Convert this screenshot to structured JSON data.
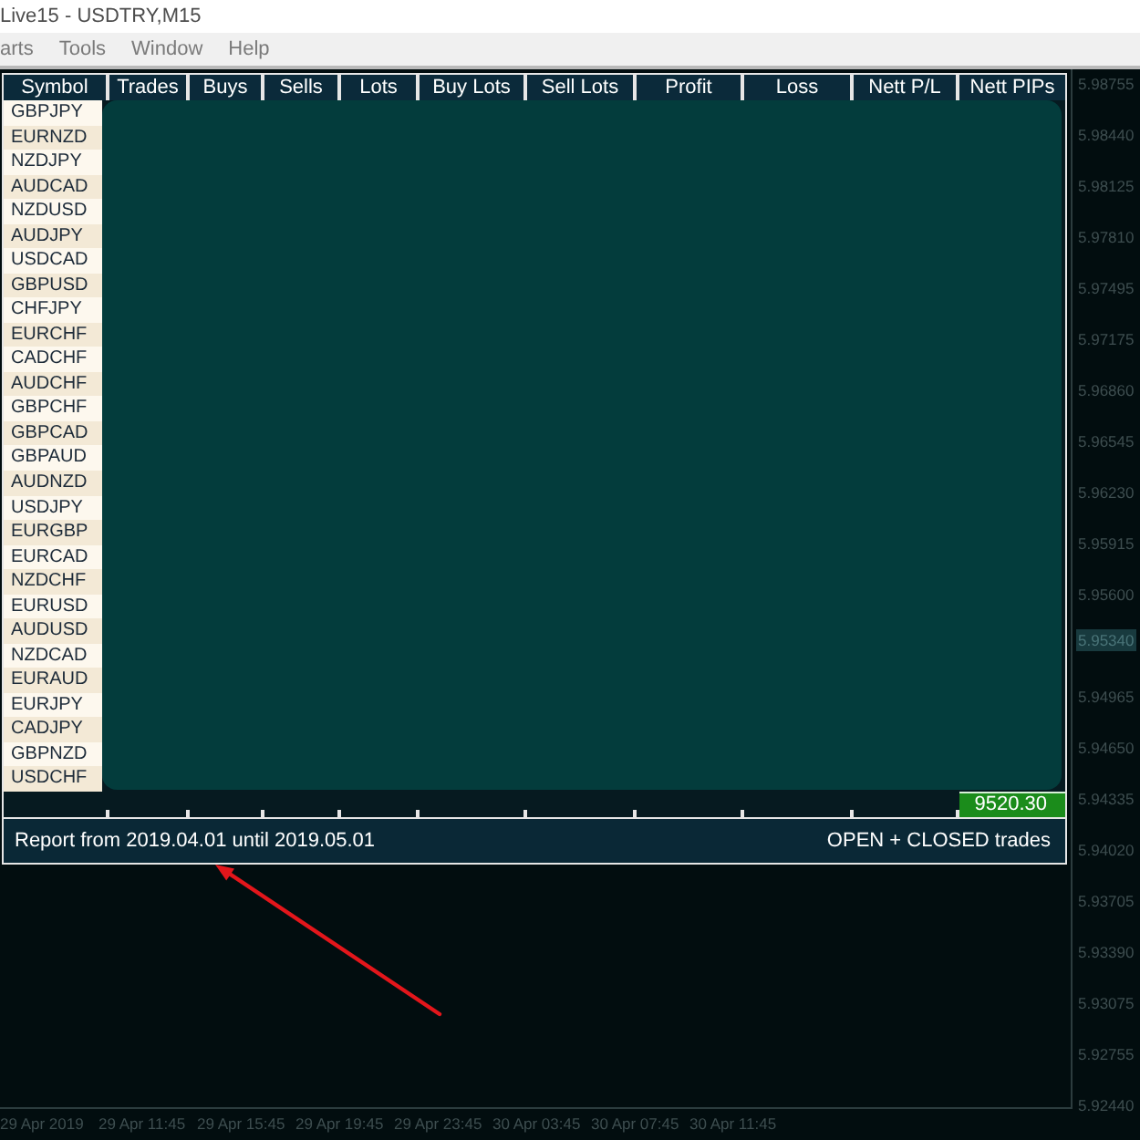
{
  "window": {
    "title": "Live15 - USDTRY,M15"
  },
  "menu": [
    "arts",
    "Tools",
    "Window",
    "Help"
  ],
  "report_panel": {
    "columns": [
      "Symbol",
      "Trades",
      "Buys",
      "Sells",
      "Lots",
      "Buy Lots",
      "Sell Lots",
      "Profit",
      "Loss",
      "Nett P/L",
      "Nett PIPs"
    ],
    "symbols": [
      "GBPJPY",
      "EURNZD",
      "NZDJPY",
      "AUDCAD",
      "NZDUSD",
      "AUDJPY",
      "USDCAD",
      "GBPUSD",
      "CHFJPY",
      "EURCHF",
      "CADCHF",
      "AUDCHF",
      "GBPCHF",
      "GBPCAD",
      "GBPAUD",
      "AUDNZD",
      "USDJPY",
      "EURGBP",
      "EURCAD",
      "NZDCHF",
      "EURUSD",
      "AUDUSD",
      "NZDCAD",
      "EURAUD",
      "EURJPY",
      "CADJPY",
      "GBPNZD",
      "USDCHF"
    ],
    "totals_row": {
      "nett_pips": "9520.30"
    },
    "footer": {
      "period": "Report from 2019.04.01 until 2019.05.01",
      "filter": "OPEN + CLOSED trades"
    }
  },
  "price_axis": [
    {
      "kind": "tick",
      "label": "5.98755"
    },
    {
      "kind": "tick",
      "label": "5.98440"
    },
    {
      "kind": "tick",
      "label": "5.98125"
    },
    {
      "kind": "tick",
      "label": "5.97810"
    },
    {
      "kind": "tick",
      "label": "5.97495"
    },
    {
      "kind": "tick",
      "label": "5.97175"
    },
    {
      "kind": "tick",
      "label": "5.96860"
    },
    {
      "kind": "tick",
      "label": "5.96545"
    },
    {
      "kind": "tick",
      "label": "5.96230"
    },
    {
      "kind": "tick",
      "label": "5.95915"
    },
    {
      "kind": "tick",
      "label": "5.95600"
    },
    {
      "kind": "current",
      "label": "5.95340"
    },
    {
      "kind": "tick",
      "label": "5.94965"
    },
    {
      "kind": "tick",
      "label": "5.94650"
    },
    {
      "kind": "tick",
      "label": "5.94335"
    },
    {
      "kind": "tick",
      "label": "5.94020"
    },
    {
      "kind": "tick",
      "label": "5.93705"
    },
    {
      "kind": "tick",
      "label": "5.93390"
    },
    {
      "kind": "tick",
      "label": "5.93075"
    },
    {
      "kind": "tick",
      "label": "5.92755"
    },
    {
      "kind": "tick",
      "label": "5.92440"
    }
  ],
  "time_axis": [
    "29 Apr 2019",
    "29 Apr 11:45",
    "29 Apr 15:45",
    "29 Apr 19:45",
    "29 Apr 23:45",
    "30 Apr 03:45",
    "30 Apr 07:45",
    "30 Apr 11:45"
  ],
  "annotations": [
    {
      "kind": "arrow"
    }
  ]
}
